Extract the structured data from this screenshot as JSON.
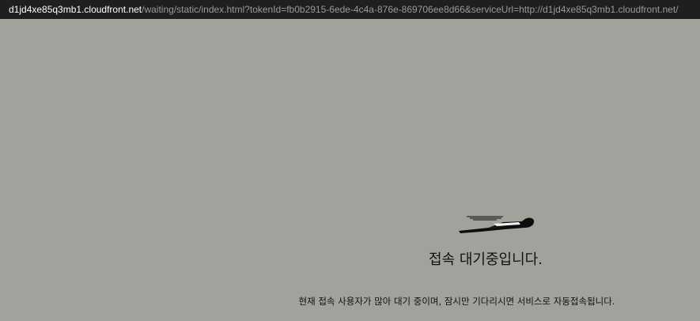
{
  "browser": {
    "url_host": "d1jd4xe85q3mb1.cloudfront.net",
    "url_path": "/waiting/static/index.html?tokenId=fb0b2915-6ede-4c4a-876e-869706ee8d66&serviceUrl=http://d1jd4xe85q3mb1.cloudfront.net/"
  },
  "waiting": {
    "logo_icon": "flying-person-icon",
    "title": "접속 대기중입니다.",
    "message": "현재 접속 사용자가 많아 대기 중이며, 잠시만 기다리시면 서비스로 자동접속됩니다."
  },
  "colors": {
    "background": "#a3a19c",
    "url_bar": "#1f1f1f",
    "text": "#111111"
  }
}
